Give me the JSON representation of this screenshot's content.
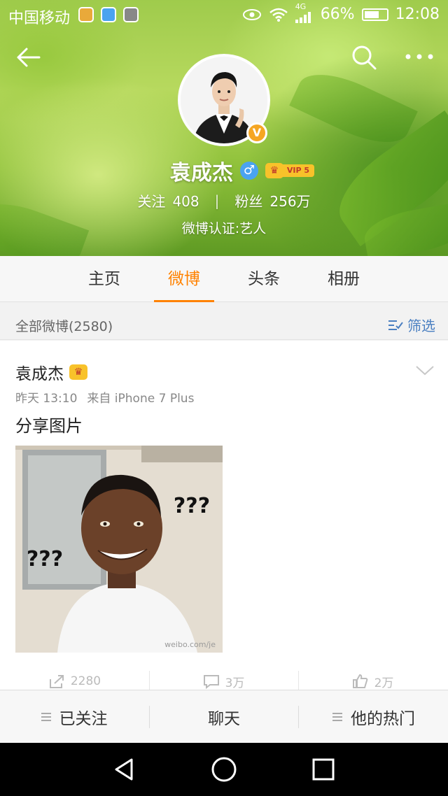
{
  "status_bar": {
    "carrier": "中国移动",
    "network": "4G",
    "battery": "66%",
    "battery_level": 0.66,
    "time": "12:08"
  },
  "profile": {
    "name": "袁成杰",
    "gender_symbol": "♂",
    "vip_label": "VIP 5",
    "verified_mark": "V",
    "following_label": "关注",
    "following_count": "408",
    "followers_label": "粉丝",
    "followers_count": "256万",
    "certification": "微博认证:艺人"
  },
  "tabs": [
    {
      "label": "主页",
      "active": false
    },
    {
      "label": "微博",
      "active": true
    },
    {
      "label": "头条",
      "active": false
    },
    {
      "label": "相册",
      "active": false
    }
  ],
  "filter": {
    "count_label": "全部微博(2580)",
    "filter_label": "筛选"
  },
  "post": {
    "author": "袁成杰",
    "time": "昨天 13:10",
    "source": "来自 iPhone 7 Plus",
    "text": "分享图片",
    "image_marks": [
      "???",
      "???"
    ],
    "image_watermark": "weibo.com/je",
    "actions": [
      {
        "icon": "repost-icon",
        "count": "2280"
      },
      {
        "icon": "comment-icon",
        "count": "3万"
      },
      {
        "icon": "like-icon",
        "count": "2万"
      }
    ]
  },
  "bottom_bar": {
    "follow_label": "已关注",
    "chat_label": "聊天",
    "hot_label": "他的热门"
  },
  "colors": {
    "accent": "#ff8200",
    "link": "#4a7fc1",
    "verify_badge": "#f5a623",
    "vip_gold": "#f8c22a"
  }
}
